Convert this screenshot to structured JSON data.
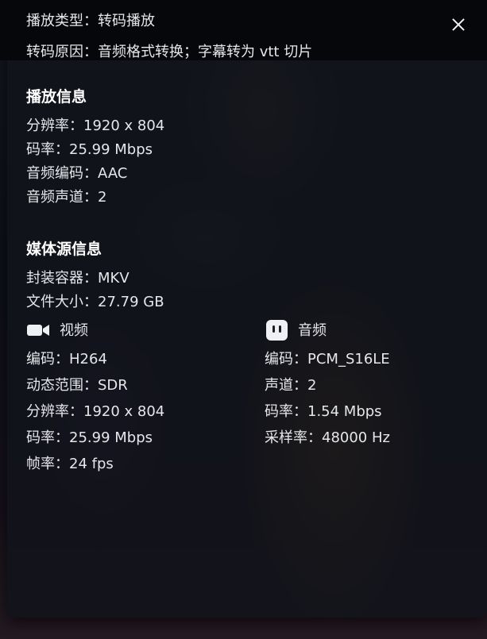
{
  "header": {
    "play_type": "播放类型：转码播放",
    "transcode_reason": "转码原因：音频格式转换；字幕转为 vtt 切片"
  },
  "playback": {
    "title": "播放信息",
    "resolution": "分辨率：1920 x 804",
    "bitrate": "码率：25.99 Mbps",
    "audio_codec": "音频编码：AAC",
    "audio_channels": "音频声道：2"
  },
  "media_source": {
    "title": "媒体源信息",
    "container": "封装容器：MKV",
    "file_size": "文件大小：27.79 GB"
  },
  "video": {
    "title": "视频",
    "icon": "video-camera-icon",
    "codec": "编码：H264",
    "dynamic_range": "动态范围：SDR",
    "resolution": "分辨率：1920 x 804",
    "bitrate": "码率：25.99 Mbps",
    "frame_rate": "帧率：24 fps"
  },
  "audio": {
    "title": "音频",
    "icon": "audio-equalizer-icon",
    "codec": "编码：PCM_S16LE",
    "channels": "声道：2",
    "bitrate": "码率：1.54 Mbps",
    "sample_rate": "采样率：48000 Hz"
  },
  "close_icon": "close-icon"
}
